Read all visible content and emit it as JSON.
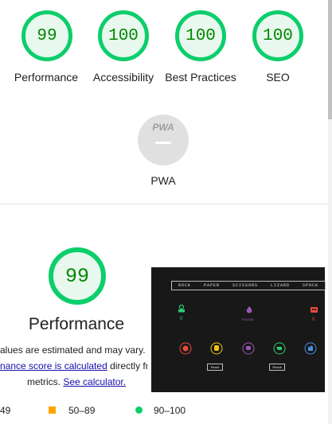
{
  "categories": [
    {
      "score": "99",
      "label": "Performance"
    },
    {
      "score": "100",
      "label": "Accessibility"
    },
    {
      "score": "100",
      "label": "Best Practices"
    },
    {
      "score": "100",
      "label": "SEO"
    }
  ],
  "pwa": {
    "badge": "PWA",
    "label": "PWA"
  },
  "performance": {
    "score": "99",
    "title": "Performance",
    "desc_line1": "alues are estimated and may vary. T",
    "desc_link1": "nance score is calculated",
    "desc_line2_rest": " directly fro",
    "desc_line3_pre": "metrics. ",
    "desc_link2": "See calculator."
  },
  "legend": [
    {
      "text": "49",
      "color": "#ff4e42"
    },
    {
      "text": "50–89",
      "color": "#ffa400"
    },
    {
      "text": "90–100",
      "color": "#0cce6b"
    }
  ],
  "screenshot": {
    "choices": [
      "ROCK",
      "PAPER",
      "SCISSORS",
      "LIZARD",
      "SPOCK"
    ],
    "player_score": "0",
    "vs_label": "ROUND",
    "cpu_score": "0",
    "reset_label": "Reset",
    "result_label": "Result",
    "colors": {
      "player": "#2ecc71",
      "vs": "#9b59b6",
      "cpu": "#e74c3c",
      "choice1": "#e74c3c",
      "choice2": "#f1c40f",
      "choice3": "#9b59b6",
      "choice4": "#2ecc71",
      "choice5": "#4a90e2"
    }
  }
}
